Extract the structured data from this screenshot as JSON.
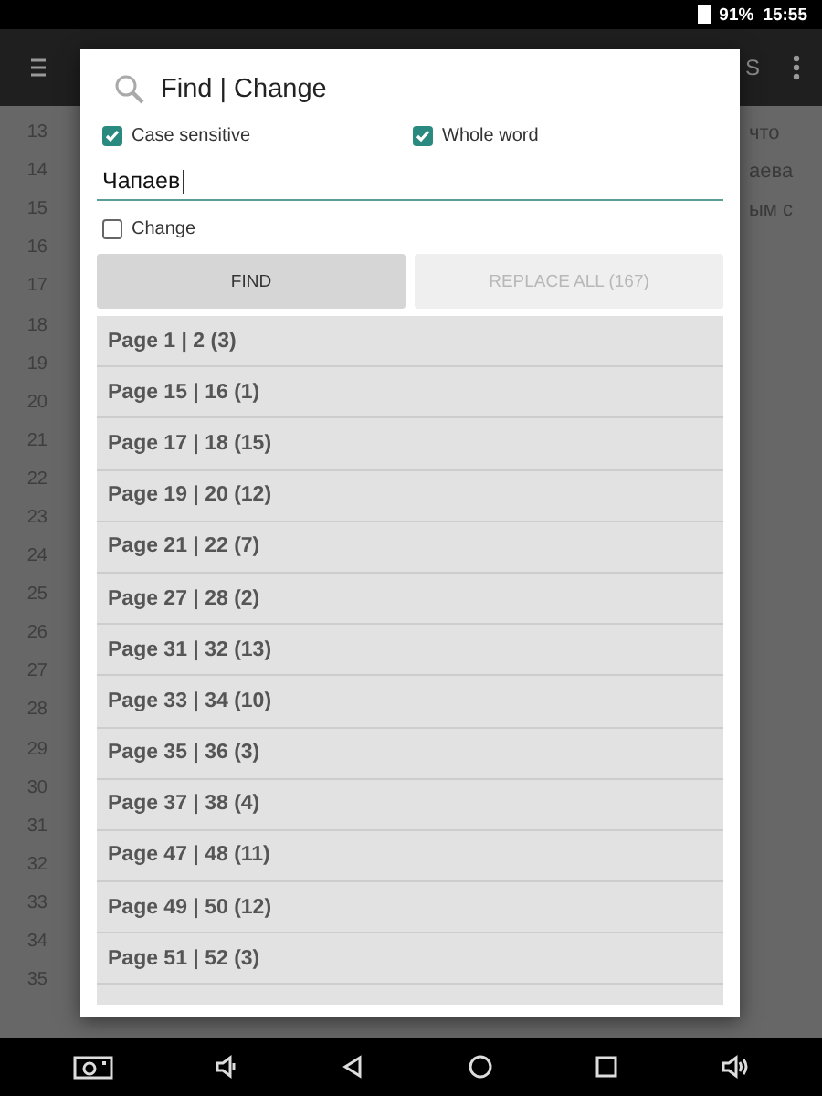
{
  "status_bar": {
    "battery": "91%",
    "time": "15:55"
  },
  "app_bar": {
    "action_text": "S"
  },
  "background_text": {
    "line_numbers": [
      "13",
      "14",
      "15",
      "16",
      "17",
      "18",
      "19",
      "20",
      "21",
      "22",
      "23",
      "24",
      "25",
      "26",
      "27",
      "28",
      "29",
      "30",
      "31",
      "32",
      "33",
      "34",
      "35"
    ],
    "fragments": [
      "что",
      "аева",
      "ым с"
    ]
  },
  "dialog": {
    "title": "Find | Change",
    "options": [
      {
        "label": "Case sensitive",
        "checked": true
      },
      {
        "label": "Whole word",
        "checked": true
      }
    ],
    "search_field": {
      "value": "Чапаев"
    },
    "change_option": {
      "label": "Change",
      "checked": false
    },
    "buttons": [
      {
        "label": "FIND",
        "disabled": false
      },
      {
        "label": "REPLACE ALL (167)",
        "disabled": true
      }
    ],
    "results": [
      "Page 1 | 2 (3)",
      "Page 15 | 16 (1)",
      "Page 17 | 18 (15)",
      "Page 19 | 20 (12)",
      "Page 21 | 22 (7)",
      "Page 27 | 28 (2)",
      "Page 31 | 32 (13)",
      "Page 33 | 34 (10)",
      "Page 35 | 36 (3)",
      "Page 37 | 38 (4)",
      "Page 47 | 48 (11)",
      "Page 49 | 50 (12)",
      "Page 51 | 52 (3)"
    ]
  }
}
